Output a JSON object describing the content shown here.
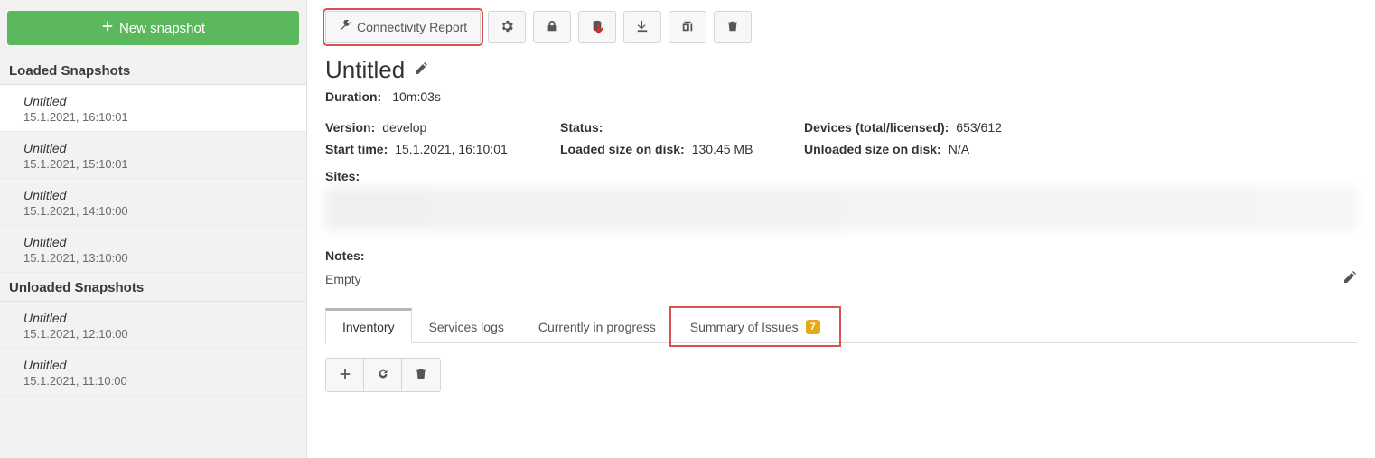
{
  "sidebar": {
    "new_snapshot_label": "New snapshot",
    "loaded_header": "Loaded Snapshots",
    "unloaded_header": "Unloaded Snapshots",
    "loaded": [
      {
        "title": "Untitled",
        "time": "15.1.2021, 16:10:01",
        "active": true
      },
      {
        "title": "Untitled",
        "time": "15.1.2021, 15:10:01",
        "active": false
      },
      {
        "title": "Untitled",
        "time": "15.1.2021, 14:10:00",
        "active": false
      },
      {
        "title": "Untitled",
        "time": "15.1.2021, 13:10:00",
        "active": false
      }
    ],
    "unloaded": [
      {
        "title": "Untitled",
        "time": "15.1.2021, 12:10:00"
      },
      {
        "title": "Untitled",
        "time": "15.1.2021, 11:10:00"
      }
    ]
  },
  "toolbar": {
    "connectivity_label": "Connectivity Report"
  },
  "page": {
    "title": "Untitled",
    "duration_label": "Duration:",
    "duration_value": "10m:03s",
    "version_label": "Version:",
    "version_value": "develop",
    "status_label": "Status:",
    "status_value": "",
    "devices_label": "Devices (total/licensed):",
    "devices_value": "653/612",
    "start_label": "Start time:",
    "start_value": "15.1.2021, 16:10:01",
    "loaded_size_label": "Loaded size on disk:",
    "loaded_size_value": "130.45 MB",
    "unloaded_size_label": "Unloaded size on disk:",
    "unloaded_size_value": "N/A",
    "sites_label": "Sites:",
    "notes_label": "Notes:",
    "notes_value": "Empty"
  },
  "tabs": {
    "inventory": "Inventory",
    "services": "Services logs",
    "progress": "Currently in progress",
    "issues": "Summary of Issues",
    "issues_badge": "7"
  }
}
